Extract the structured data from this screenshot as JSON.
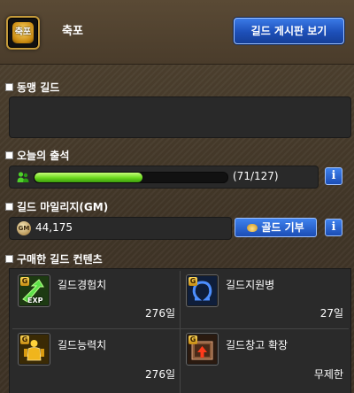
{
  "header": {
    "emblem_text": "축포",
    "guild_name": "축포",
    "board_button": "길드 게시판 보기"
  },
  "sections": {
    "ally": "동맹 길드",
    "attendance": "오늘의 출석",
    "mileage": "길드 마일리지(GM)",
    "contents": "구매한 길드 컨텐츠"
  },
  "attendance": {
    "current": 71,
    "total": 127,
    "text": "(71/127)",
    "progress": 0.56
  },
  "mileage": {
    "coin_label": "GM",
    "value": "44,175",
    "gold_button": "골드 기부"
  },
  "info_icon": "i",
  "contents": [
    {
      "name": "길드경험치",
      "days": "276일",
      "icon": "exp-arrow-icon",
      "badge": "G",
      "icon_text": "EXP"
    },
    {
      "name": "길드지원병",
      "days": "27일",
      "icon": "omega-icon",
      "badge": "G"
    },
    {
      "name": "길드능력치",
      "days": "276일",
      "icon": "gold-figure-icon",
      "badge": "G"
    },
    {
      "name": "길드창고 확장",
      "days": "무제한",
      "icon": "storage-expand-icon",
      "badge": "G"
    }
  ],
  "colors": {
    "button_blue": "#1d4fb8",
    "bar_green": "#6ad81c",
    "panel_dark": "#292929",
    "background_brown": "#3f3426"
  }
}
